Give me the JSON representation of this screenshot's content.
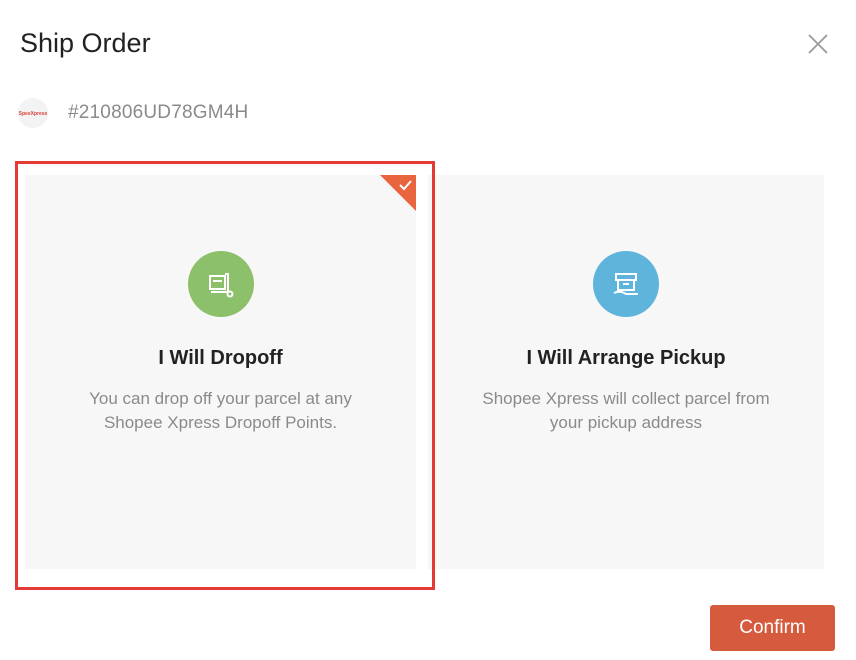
{
  "dialog": {
    "title": "Ship Order",
    "close_icon": "close-icon"
  },
  "order": {
    "logo_icon": "shopee-xpress-logo",
    "logo_text": "SpeeXpress",
    "id": "#210806UD78GM4H"
  },
  "options": [
    {
      "title": "I Will Dropoff",
      "desc_line1": "You can drop off your parcel at any",
      "desc_line2": "Shopee Xpress Dropoff Points.",
      "icon": "dropoff-cart-icon",
      "icon_bg": "#8dc06a",
      "selected": true
    },
    {
      "title": "I Will Arrange Pickup",
      "desc_line1": "Shopee Xpress will collect parcel from",
      "desc_line2": "your pickup address",
      "icon": "pickup-box-icon",
      "icon_bg": "#5fb4dc",
      "selected": false
    }
  ],
  "colors": {
    "accent": "#d65a3d",
    "selected_border": "#e53935",
    "corner_check": "#e8653f"
  },
  "footer": {
    "confirm_label": "Confirm"
  }
}
